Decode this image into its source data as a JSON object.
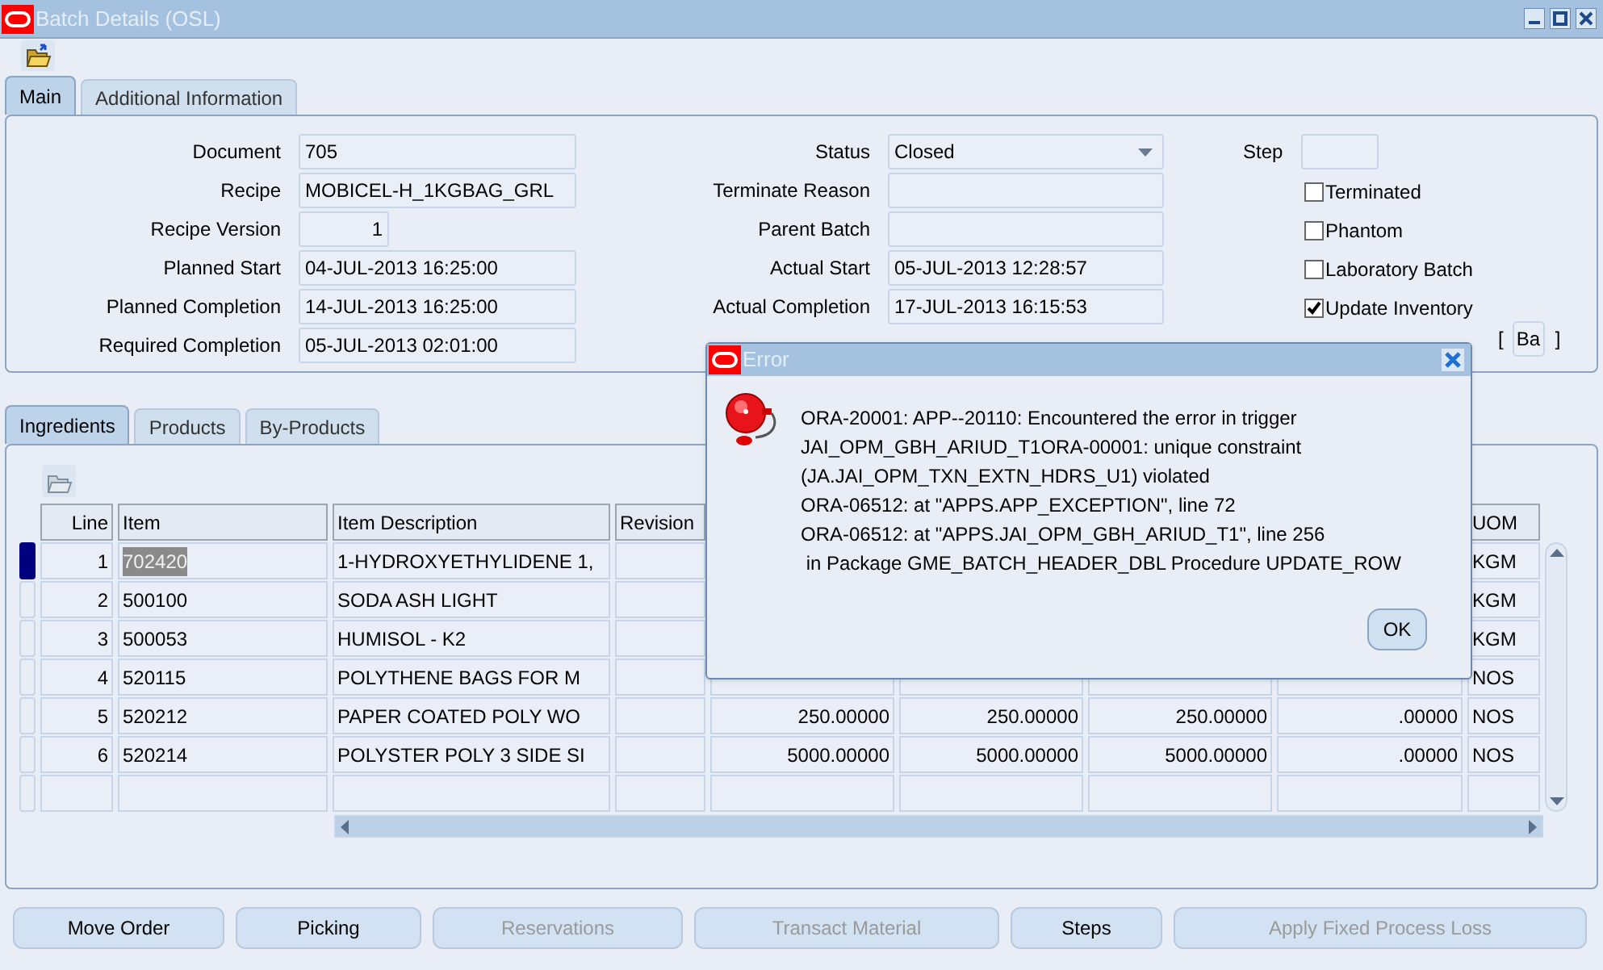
{
  "window": {
    "title": "Batch Details (OSL)"
  },
  "tabs": [
    {
      "label": "Main",
      "selected": true
    },
    {
      "label": "Additional Information",
      "selected": false
    }
  ],
  "form_left": [
    {
      "label": "Document",
      "value": "705"
    },
    {
      "label": "Recipe",
      "value": "MOBICEL-H_1KGBAG_GRL"
    },
    {
      "label": "Recipe Version",
      "value": "1",
      "kind": "number"
    },
    {
      "label": "Planned Start",
      "value": "04-JUL-2013 16:25:00"
    },
    {
      "label": "Planned Completion",
      "value": "14-JUL-2013 16:25:00"
    },
    {
      "label": "Required Completion",
      "value": "05-JUL-2013 02:01:00"
    }
  ],
  "form_middle": [
    {
      "label": "Status",
      "value": "Closed",
      "kind": "dropdown"
    },
    {
      "label": "Terminate Reason"
    },
    {
      "label": "Parent Batch"
    },
    {
      "label": "Actual Start",
      "value": "05-JUL-2013 12:28:57"
    },
    {
      "label": "Actual Completion",
      "value": "17-JUL-2013 16:15:53"
    }
  ],
  "step": {
    "label": "Step"
  },
  "checkboxes": [
    {
      "label": "Terminated",
      "checked": false
    },
    {
      "label": "Phantom",
      "checked": false
    },
    {
      "label": "Laboratory Batch",
      "checked": false
    },
    {
      "label": "Update Inventory",
      "checked": true
    }
  ],
  "side_button": {
    "open_bracket": "[",
    "label": "Ba",
    "close_bracket": "]"
  },
  "detail_tabs": [
    {
      "label": "Ingredients",
      "selected": true
    },
    {
      "label": "Products",
      "selected": false
    },
    {
      "label": "By-Products",
      "selected": false
    }
  ],
  "table": {
    "columns": [
      {
        "label": "Line"
      },
      {
        "label": "Item"
      },
      {
        "label": "Item Description"
      },
      {
        "label": "Revision"
      },
      {},
      {},
      {},
      {},
      {
        "label": "UOM"
      }
    ],
    "rows": [
      {
        "selected": true,
        "cells": [
          "1",
          "702420",
          "1-HYDROXYETHYLIDENE 1,",
          null,
          null,
          null,
          null,
          null,
          "KGM"
        ]
      },
      {
        "selected": false,
        "cells": [
          "2",
          "500100",
          "SODA ASH LIGHT",
          null,
          null,
          null,
          null,
          null,
          "KGM"
        ]
      },
      {
        "selected": false,
        "cells": [
          "3",
          "500053",
          "HUMISOL - K2",
          null,
          null,
          null,
          null,
          null,
          "KGM"
        ]
      },
      {
        "selected": false,
        "cells": [
          "4",
          "520115",
          "POLYTHENE BAGS FOR M",
          null,
          null,
          null,
          null,
          null,
          "NOS"
        ]
      },
      {
        "selected": false,
        "cells": [
          "5",
          "520212",
          "PAPER COATED POLY WO",
          null,
          "250.00000",
          "250.00000",
          "250.00000",
          ".00000",
          "NOS"
        ]
      },
      {
        "selected": false,
        "cells": [
          "6",
          "520214",
          "POLYSTER POLY 3 SIDE SI",
          null,
          "5000.00000",
          "5000.00000",
          "5000.00000",
          ".00000",
          "NOS"
        ]
      }
    ]
  },
  "buttons": [
    {
      "label": "Move Order",
      "disabled": false
    },
    {
      "label": "Picking",
      "disabled": false
    },
    {
      "label": "Reservations",
      "disabled": true
    },
    {
      "label": "Transact Material",
      "disabled": true
    },
    {
      "label": "Steps",
      "disabled": false
    },
    {
      "label": "Apply Fixed Process Loss",
      "disabled": true
    }
  ],
  "dialog": {
    "title": "Error",
    "lines": [
      "ORA-20001: APP--20110: Encountered the error in trigger",
      "JAI_OPM_GBH_ARIUD_T1ORA-00001: unique constraint",
      "(JA.JAI_OPM_TXN_EXTN_HDRS_U1) violated",
      "ORA-06512: at \"APPS.APP_EXCEPTION\", line 72",
      "ORA-06512: at \"APPS.JAI_OPM_GBH_ARIUD_T1\", line 256",
      " in Package GME_BATCH_HEADER_DBL Procedure UPDATE_ROW"
    ],
    "ok": "OK"
  }
}
